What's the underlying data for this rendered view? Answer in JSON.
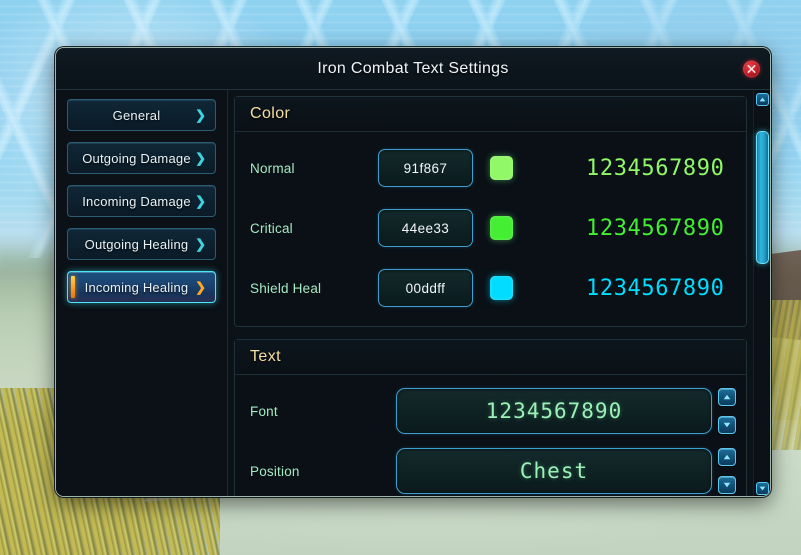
{
  "window": {
    "title": "Iron Combat Text Settings",
    "close_icon": "close-x-icon"
  },
  "sidebar": {
    "items": [
      {
        "label": "General",
        "chevron": "❯",
        "selected": false
      },
      {
        "label": "Outgoing Damage",
        "chevron": "❯",
        "selected": false
      },
      {
        "label": "Incoming Damage",
        "chevron": "❯",
        "selected": false
      },
      {
        "label": "Outgoing Healing",
        "chevron": "❯",
        "selected": false
      },
      {
        "label": "Incoming Healing",
        "chevron": "❯",
        "selected": true
      }
    ]
  },
  "sections": [
    {
      "title": "Color",
      "rows": [
        {
          "label": "Normal",
          "value": "91f867",
          "swatch_color": "#91f867",
          "sample_text": "1234567890",
          "sample_color": "#91f867"
        },
        {
          "label": "Critical",
          "value": "44ee33",
          "swatch_color": "#44ee33",
          "sample_text": "1234567890",
          "sample_color": "#44ee33"
        },
        {
          "label": "Shield Heal",
          "value": "00ddff",
          "swatch_color": "#00ddff",
          "sample_text": "1234567890",
          "sample_color": "#00ddff"
        }
      ]
    },
    {
      "title": "Text",
      "rows": [
        {
          "label": "Font",
          "value": "1234567890",
          "up_icon": "chevron-up-icon",
          "down_icon": "chevron-down-icon"
        },
        {
          "label": "Position",
          "value": "Chest",
          "up_icon": "chevron-up-icon",
          "down_icon": "chevron-down-icon"
        }
      ]
    }
  ],
  "scrollbar": {
    "up_icon": "scroll-up-icon",
    "down_icon": "scroll-down-icon",
    "thumb_position_percent": 6,
    "thumb_size_percent": 36
  }
}
